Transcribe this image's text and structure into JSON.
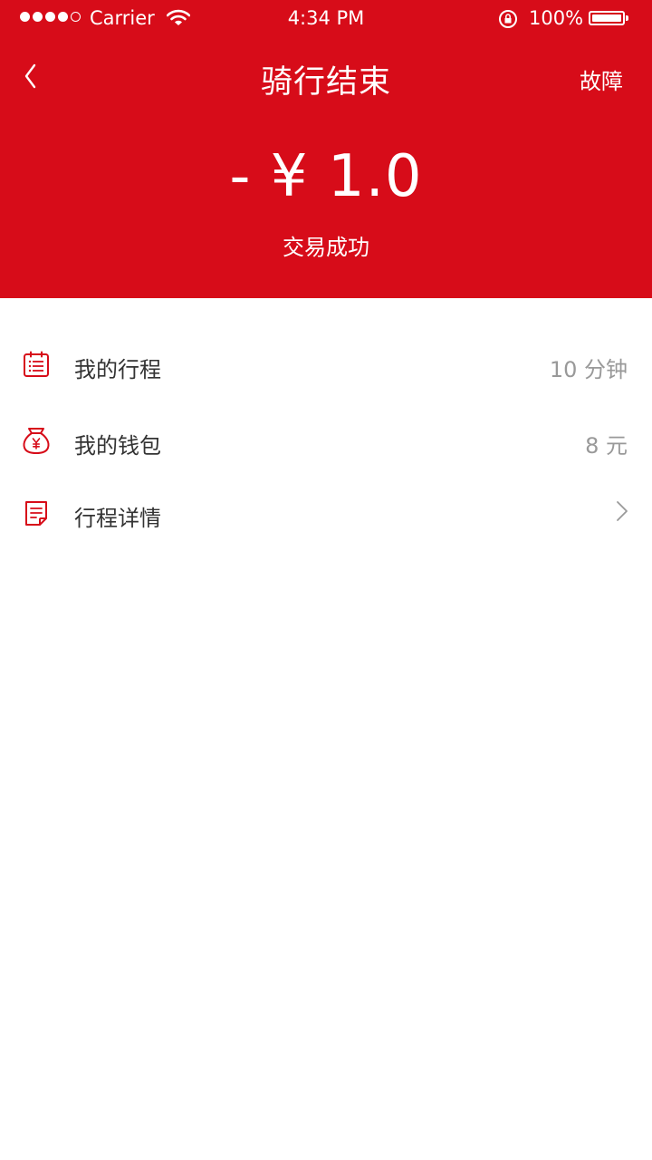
{
  "status_bar": {
    "carrier": "Carrier",
    "time": "4:34 PM",
    "battery": "100%"
  },
  "nav": {
    "title": "骑行结束",
    "action": "故障",
    "back_icon": "chevron-left-icon"
  },
  "payment": {
    "amount": "- ¥ 1.0",
    "status": "交易成功"
  },
  "menu": [
    {
      "label": "我的行程",
      "value": "10 分钟",
      "icon": "calendar-list-icon"
    },
    {
      "label": "我的钱包",
      "value": "8 元",
      "icon": "money-bag-icon"
    },
    {
      "label": "行程详情",
      "value": "",
      "icon": "document-icon"
    }
  ],
  "colors": {
    "brand_red": "#d70c19",
    "text_primary": "#333333",
    "text_secondary": "#999999"
  }
}
